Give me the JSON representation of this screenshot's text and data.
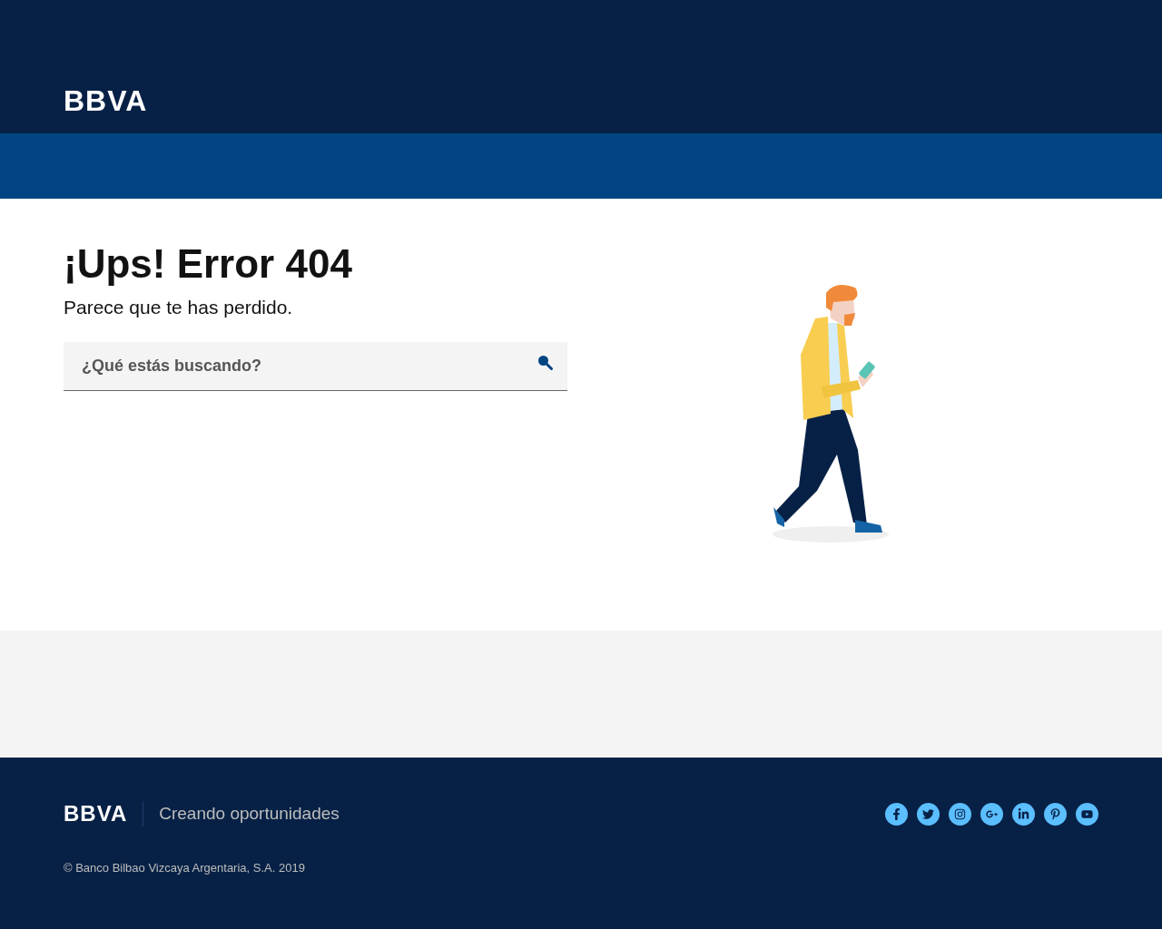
{
  "header": {
    "logo": "BBVA"
  },
  "error": {
    "title": "¡Ups! Error 404",
    "subtitle": "Parece que te has perdido.",
    "search": {
      "placeholder": "¿Qué estás buscando?"
    }
  },
  "footer": {
    "logo": "BBVA",
    "tagline": "Creando oportunidades",
    "copyright": "© Banco Bilbao Vizcaya Argentaria, S.A. 2019"
  }
}
